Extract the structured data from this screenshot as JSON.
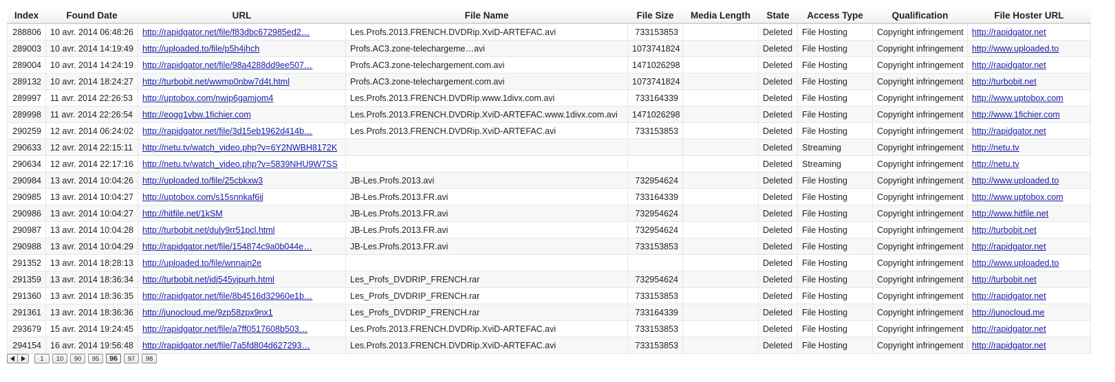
{
  "table": {
    "columns": [
      "Index",
      "Found Date",
      "URL",
      "File Name",
      "File Size",
      "Media Length",
      "State",
      "Access Type",
      "Qualification",
      "File Hoster URL"
    ],
    "rows": [
      {
        "index": "288806",
        "found_date": "10 avr. 2014 06:48:26",
        "url": "http://rapidgator.net/file/f83dbc672985ed2…",
        "file_name": "Les.Profs.2013.FRENCH.DVDRip.XviD-ARTEFAC.avi",
        "file_size": "733153853",
        "media_length": "",
        "state": "Deleted",
        "access_type": "File Hosting",
        "qualification": "Copyright infringement",
        "hoster_url": "http://rapidgator.net"
      },
      {
        "index": "289003",
        "found_date": "10 avr. 2014 14:19:49",
        "url": "http://uploaded.to/file/p5h4jhch",
        "file_name": "Profs.AC3.zone-telechargeme…avi",
        "file_size": "1073741824",
        "media_length": "",
        "state": "Deleted",
        "access_type": "File Hosting",
        "qualification": "Copyright infringement",
        "hoster_url": "http://www.uploaded.to"
      },
      {
        "index": "289004",
        "found_date": "10 avr. 2014 14:24:19",
        "url": "http://rapidgator.net/file/98a4288dd9ee507…",
        "file_name": "Profs.AC3.zone-telechargement.com.avi",
        "file_size": "1471026298",
        "media_length": "",
        "state": "Deleted",
        "access_type": "File Hosting",
        "qualification": "Copyright infringement",
        "hoster_url": "http://rapidgator.net"
      },
      {
        "index": "289132",
        "found_date": "10 avr. 2014 18:24:27",
        "url": "http://turbobit.net/wwmp0nbw7d4t.html",
        "file_name": "Profs.AC3.zone-telechargement.com.avi",
        "file_size": "1073741824",
        "media_length": "",
        "state": "Deleted",
        "access_type": "File Hosting",
        "qualification": "Copyright infringement",
        "hoster_url": "http://turbobit.net"
      },
      {
        "index": "289997",
        "found_date": "11 avr. 2014 22:26:53",
        "url": "http://uptobox.com/nwjp6gamjom4",
        "file_name": "Les.Profs.2013.FRENCH.DVDRip.www.1divx.com.avi",
        "file_size": "733164339",
        "media_length": "",
        "state": "Deleted",
        "access_type": "File Hosting",
        "qualification": "Copyright infringement",
        "hoster_url": "http://www.uptobox.com"
      },
      {
        "index": "289998",
        "found_date": "11 avr. 2014 22:26:54",
        "url": "http://eogg1vbw.1fichier.com",
        "file_name": "Les.Profs.2013.FRENCH.DVDRip.XviD-ARTEFAC.www.1divx.com.avi",
        "file_size": "1471026298",
        "media_length": "",
        "state": "Deleted",
        "access_type": "File Hosting",
        "qualification": "Copyright infringement",
        "hoster_url": "http://www.1fichier.com"
      },
      {
        "index": "290259",
        "found_date": "12 avr. 2014 06:24:02",
        "url": "http://rapidgator.net/file/3d15eb1962d414b…",
        "file_name": "Les.Profs.2013.FRENCH.DVDRip.XviD-ARTEFAC.avi",
        "file_size": "733153853",
        "media_length": "",
        "state": "Deleted",
        "access_type": "File Hosting",
        "qualification": "Copyright infringement",
        "hoster_url": "http://rapidgator.net"
      },
      {
        "index": "290633",
        "found_date": "12 avr. 2014 22:15:11",
        "url": "http://netu.tv/watch_video.php?v=6Y2NWBH8172K",
        "file_name": "",
        "file_size": "",
        "media_length": "",
        "state": "Deleted",
        "access_type": "Streaming",
        "qualification": "Copyright infringement",
        "hoster_url": "http://netu.tv"
      },
      {
        "index": "290634",
        "found_date": "12 avr. 2014 22:17:16",
        "url": "http://netu.tv/watch_video.php?v=5839NHU9W7SS",
        "file_name": "",
        "file_size": "",
        "media_length": "",
        "state": "Deleted",
        "access_type": "Streaming",
        "qualification": "Copyright infringement",
        "hoster_url": "http://netu.tv"
      },
      {
        "index": "290984",
        "found_date": "13 avr. 2014 10:04:26",
        "url": "http://uploaded.to/file/25cbkxw3",
        "file_name": "JB-Les.Profs.2013.avi",
        "file_size": "732954624",
        "media_length": "",
        "state": "Deleted",
        "access_type": "File Hosting",
        "qualification": "Copyright infringement",
        "hoster_url": "http://www.uploaded.to"
      },
      {
        "index": "290985",
        "found_date": "13 avr. 2014 10:04:27",
        "url": "http://uptobox.com/s15snnkaf6ij",
        "file_name": "JB-Les.Profs.2013.FR.avi",
        "file_size": "733164339",
        "media_length": "",
        "state": "Deleted",
        "access_type": "File Hosting",
        "qualification": "Copyright infringement",
        "hoster_url": "http://www.uptobox.com"
      },
      {
        "index": "290986",
        "found_date": "13 avr. 2014 10:04:27",
        "url": "http://hitfile.net/1kSM",
        "file_name": "JB-Les.Profs.2013.FR.avi",
        "file_size": "732954624",
        "media_length": "",
        "state": "Deleted",
        "access_type": "File Hosting",
        "qualification": "Copyright infringement",
        "hoster_url": "http://www.hitfile.net"
      },
      {
        "index": "290987",
        "found_date": "13 avr. 2014 10:04:28",
        "url": "http://turbobit.net/duly9rr51pcl.html",
        "file_name": "JB-Les.Profs.2013.FR.avi",
        "file_size": "732954624",
        "media_length": "",
        "state": "Deleted",
        "access_type": "File Hosting",
        "qualification": "Copyright infringement",
        "hoster_url": "http://turbobit.net"
      },
      {
        "index": "290988",
        "found_date": "13 avr. 2014 10:04:29",
        "url": "http://rapidgator.net/file/154874c9a0b044e…",
        "file_name": "JB-Les.Profs.2013.FR.avi",
        "file_size": "733153853",
        "media_length": "",
        "state": "Deleted",
        "access_type": "File Hosting",
        "qualification": "Copyright infringement",
        "hoster_url": "http://rapidgator.net"
      },
      {
        "index": "291352",
        "found_date": "13 avr. 2014 18:28:13",
        "url": "http://uploaded.to/file/wnnajn2e",
        "file_name": "",
        "file_size": "",
        "media_length": "",
        "state": "Deleted",
        "access_type": "File Hosting",
        "qualification": "Copyright infringement",
        "hoster_url": "http://www.uploaded.to"
      },
      {
        "index": "291359",
        "found_date": "13 avr. 2014 18:36:34",
        "url": "http://turbobit.net/idj545yjpurh.html",
        "file_name": "Les_Profs_DVDRIP_FRENCH.rar",
        "file_size": "732954624",
        "media_length": "",
        "state": "Deleted",
        "access_type": "File Hosting",
        "qualification": "Copyright infringement",
        "hoster_url": "http://turbobit.net"
      },
      {
        "index": "291360",
        "found_date": "13 avr. 2014 18:36:35",
        "url": "http://rapidgator.net/file/8b4516d32960e1b…",
        "file_name": "Les_Profs_DVDRIP_FRENCH.rar",
        "file_size": "733153853",
        "media_length": "",
        "state": "Deleted",
        "access_type": "File Hosting",
        "qualification": "Copyright infringement",
        "hoster_url": "http://rapidgator.net"
      },
      {
        "index": "291361",
        "found_date": "13 avr. 2014 18:36:36",
        "url": "http://junocloud.me/9zp58zpx9nx1",
        "file_name": "Les_Profs_DVDRIP_FRENCH.rar",
        "file_size": "733164339",
        "media_length": "",
        "state": "Deleted",
        "access_type": "File Hosting",
        "qualification": "Copyright infringement",
        "hoster_url": "http://junocloud.me"
      },
      {
        "index": "293679",
        "found_date": "15 avr. 2014 19:24:45",
        "url": "http://rapidgator.net/file/a7ff0517608b503…",
        "file_name": "Les.Profs.2013.FRENCH.DVDRip.XviD-ARTEFAC.avi",
        "file_size": "733153853",
        "media_length": "",
        "state": "Deleted",
        "access_type": "File Hosting",
        "qualification": "Copyright infringement",
        "hoster_url": "http://rapidgator.net"
      },
      {
        "index": "294154",
        "found_date": "16 avr. 2014 19:56:48",
        "url": "http://rapidgator.net/file/7a5fd804d627293…",
        "file_name": "Les.Profs.2013.FRENCH.DVDRip.XviD-ARTEFAC.avi",
        "file_size": "733153853",
        "media_length": "",
        "state": "Deleted",
        "access_type": "File Hosting",
        "qualification": "Copyright infringement",
        "hoster_url": "http://rapidgator.net"
      }
    ]
  },
  "pager": {
    "prev_icon": "triangle-left-icon",
    "next_icon": "triangle-right-icon",
    "pages": [
      "1",
      "10",
      "90",
      "95",
      "96",
      "97",
      "98"
    ],
    "current": "96"
  },
  "colors": {
    "link": "#1a1aa6",
    "row_alt": "#f7f7f7",
    "border": "#e6e6e6"
  }
}
